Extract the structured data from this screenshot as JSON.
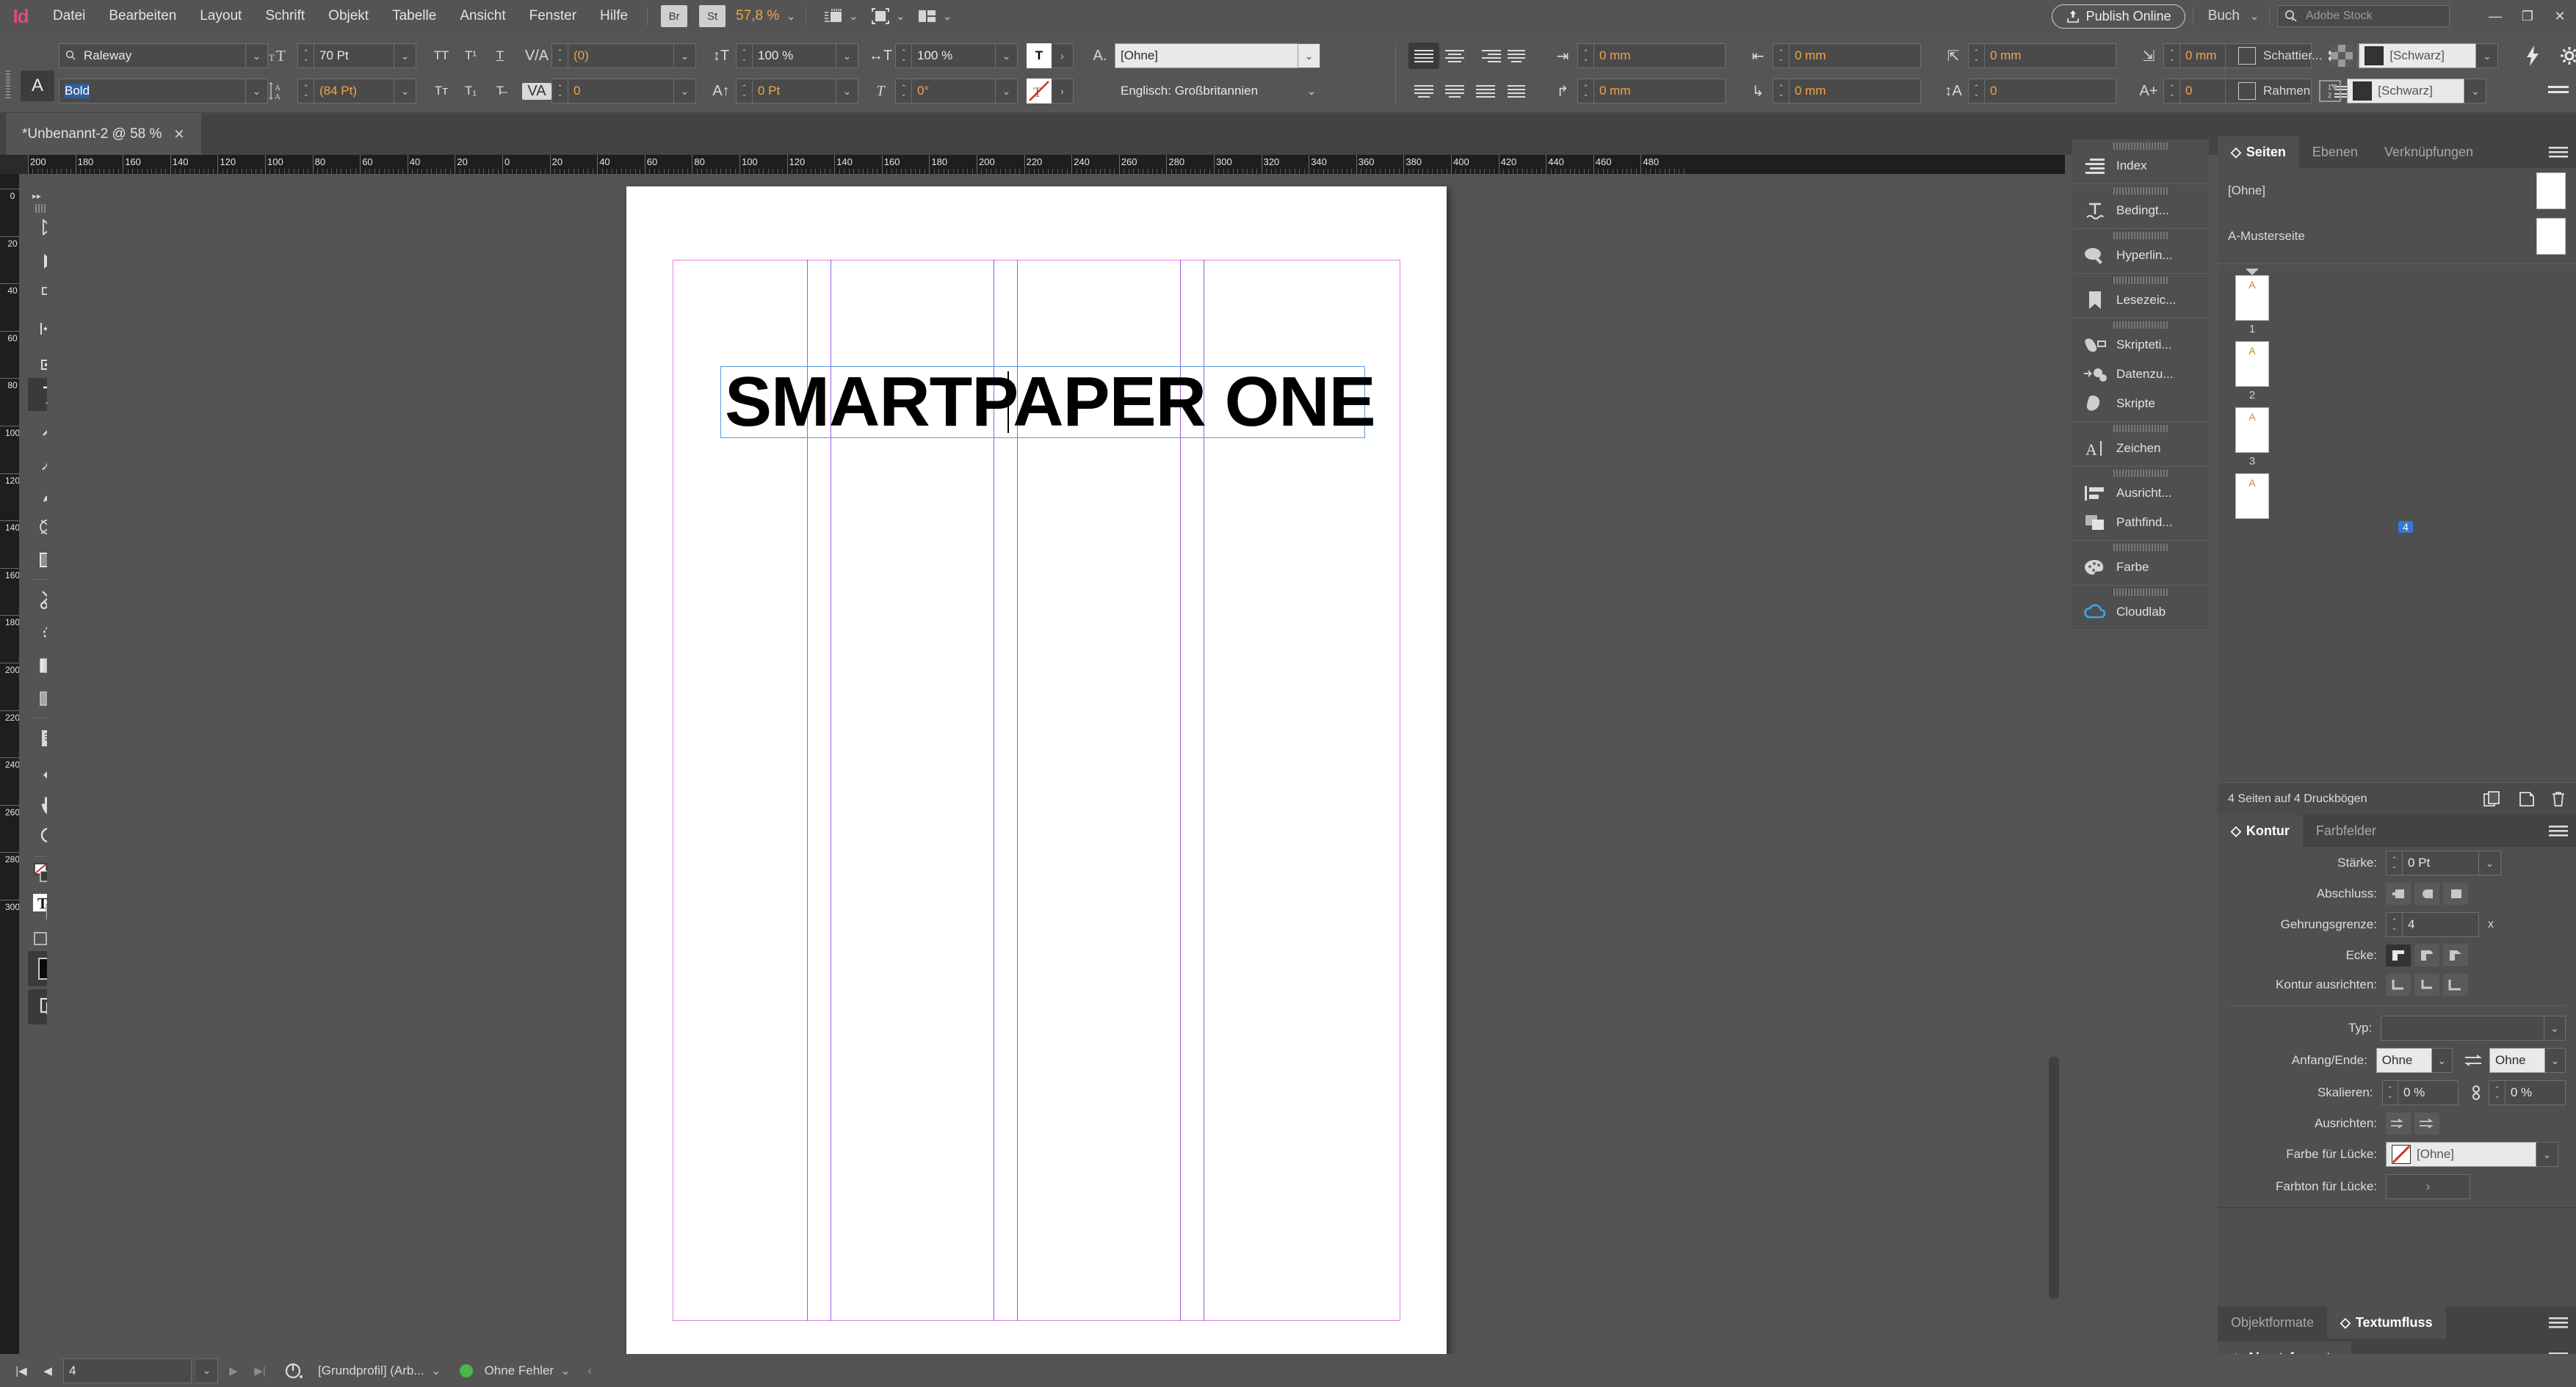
{
  "app": {
    "logo": "Id"
  },
  "menubar": {
    "items": [
      "Datei",
      "Bearbeiten",
      "Layout",
      "Schrift",
      "Objekt",
      "Tabelle",
      "Ansicht",
      "Fenster",
      "Hilfe"
    ],
    "bridge_button": "Br",
    "stock_button": "St",
    "zoom_level": "57,8 %",
    "publish_label": "Publish Online",
    "workspace": "Buch",
    "stock_placeholder": "Adobe Stock",
    "window_minimize": "—",
    "window_restore": "❐",
    "window_close": "✕"
  },
  "control": {
    "mode_char": "A",
    "mode_para": "¶",
    "font_family": "Raleway",
    "font_style": "Bold",
    "font_size": "70 Pt",
    "leading": "(84 Pt)",
    "kerning": "(0)",
    "tracking": "0",
    "vertical_scale": "100 %",
    "horizontal_scale": "100 %",
    "baseline_shift": "0 Pt",
    "skew": "0°",
    "char_style": "[Ohne]",
    "language": "Englisch: Großbritannien",
    "indent_left": "0 mm",
    "indent_right": "0 mm",
    "indent_first": "0 mm",
    "indent_last": "0 mm",
    "space_before": "0 mm",
    "space_after": "0 mm",
    "drop_cap_lines": "0",
    "drop_cap_chars": "0",
    "shadow_label": "Schattier...",
    "frame_label": "Rahmen",
    "shadow_color": "[Schwarz]",
    "frame_color": "[Schwarz]"
  },
  "document_tab": {
    "title": "*Unbenannt-2 @ 58 %",
    "close": "✕"
  },
  "rulers": {
    "horizontal": [
      "200",
      "180",
      "160",
      "140",
      "120",
      "100",
      "80",
      "60",
      "40",
      "20",
      "0",
      "20",
      "40",
      "60",
      "80",
      "100",
      "120",
      "140",
      "160",
      "180",
      "200",
      "220",
      "240",
      "260",
      "280",
      "300",
      "320",
      "340",
      "360",
      "380",
      "400",
      "420",
      "440",
      "460",
      "480"
    ],
    "vertical": [
      "0",
      "20",
      "40",
      "60",
      "80",
      "100",
      "120",
      "140",
      "160",
      "180",
      "200",
      "220",
      "240",
      "260",
      "280",
      "300"
    ],
    "unit": "mm"
  },
  "tools": {
    "items": [
      {
        "name": "selection-tool",
        "glyph": "outline-arrow"
      },
      {
        "name": "direct-selection-tool",
        "glyph": "solid-arrow"
      },
      {
        "name": "page-tool",
        "glyph": "page"
      },
      {
        "name": "gap-tool",
        "glyph": "gap"
      },
      {
        "name": "content-collector-tool",
        "glyph": "collector"
      },
      {
        "name": "type-tool",
        "glyph": "T",
        "active": true
      },
      {
        "name": "line-tool",
        "glyph": "line"
      },
      {
        "name": "pen-tool",
        "glyph": "pen"
      },
      {
        "name": "pencil-tool",
        "glyph": "pencil"
      },
      {
        "name": "ellipse-frame-tool",
        "glyph": "ellipse-frame"
      },
      {
        "name": "rectangle-tool",
        "glyph": "rectangle"
      },
      {
        "name": "scissors-tool",
        "glyph": "scissors"
      },
      {
        "name": "free-transform-tool",
        "glyph": "transform"
      },
      {
        "name": "gradient-swatch-tool",
        "glyph": "gradient"
      },
      {
        "name": "gradient-feather-tool",
        "glyph": "feather"
      },
      {
        "name": "note-tool",
        "glyph": "note"
      },
      {
        "name": "eyedropper-tool",
        "glyph": "eyedropper"
      },
      {
        "name": "hand-tool",
        "glyph": "hand"
      },
      {
        "name": "zoom-tool",
        "glyph": "magnifier"
      }
    ]
  },
  "canvas": {
    "text_frame_content": "SMARTPAPER ONE",
    "frame_border_color": "#5b9bd5",
    "margin_guide_color": "#e47fe4",
    "column_guide_color": "#9b5de5"
  },
  "dock": {
    "groups": [
      [
        {
          "label": "Index",
          "icon": "index-icon"
        }
      ],
      [
        {
          "label": "Bedingt...",
          "icon": "conditional-text-icon"
        }
      ],
      [
        {
          "label": "Hyperlin...",
          "icon": "hyperlinks-icon"
        }
      ],
      [
        {
          "label": "Lesezeic...",
          "icon": "bookmarks-icon"
        }
      ],
      [
        {
          "label": "Skripteti...",
          "icon": "script-label-icon"
        },
        {
          "label": "Datenzu...",
          "icon": "data-merge-icon"
        },
        {
          "label": "Skripte",
          "icon": "scripts-icon"
        }
      ],
      [
        {
          "label": "Zeichen",
          "icon": "character-icon"
        }
      ],
      [
        {
          "label": "Ausricht...",
          "icon": "align-icon"
        },
        {
          "label": "Pathfind...",
          "icon": "pathfinder-icon"
        }
      ],
      [
        {
          "label": "Farbe",
          "icon": "color-icon"
        }
      ],
      [
        {
          "label": "Cloudlab",
          "icon": "cloud-icon"
        }
      ]
    ]
  },
  "pages_panel": {
    "tabs": [
      "Seiten",
      "Ebenen",
      "Verknüpfungen"
    ],
    "active_tab": "Seiten",
    "masters": [
      {
        "label": "[Ohne]"
      },
      {
        "label": "A-Musterseite"
      }
    ],
    "pages": [
      {
        "master": "A",
        "number": "1",
        "selected": false
      },
      {
        "master": "A",
        "number": "2",
        "selected": false
      },
      {
        "master": "A",
        "number": "3",
        "selected": false
      },
      {
        "master": "A",
        "number": "4",
        "selected": true
      }
    ],
    "footer": "4 Seiten auf 4 Druckbögen"
  },
  "stroke_panel": {
    "tabs": [
      "Kontur",
      "Farbfelder"
    ],
    "active_tab": "Kontur",
    "weight_label": "Stärke:",
    "weight_value": "0 Pt",
    "cap_label": "Abschluss:",
    "miter_label": "Gehrungsgrenze:",
    "miter_value": "4",
    "miter_unit": "x",
    "join_label": "Ecke:",
    "align_label": "Kontur ausrichten:",
    "type_label": "Typ:",
    "type_value": "",
    "startend_label": "Anfang/Ende:",
    "start_value": "Ohne",
    "end_value": "Ohne",
    "scale_label": "Skalieren:",
    "scale_start": "0 %",
    "scale_end": "0 %",
    "arrow_align_label": "Ausrichten:",
    "gap_color_label": "Farbe für Lücke:",
    "gap_color_value": "[Ohne]",
    "gap_tint_label": "Farbton für Lücke:"
  },
  "bottom_panels": {
    "object_styles": "Objektformate",
    "text_wrap": "Textumfluss",
    "paragraph_styles": "Absatzformate"
  },
  "status": {
    "page_value": "4",
    "preflight_profile": "[Grundprofil] (Arb...",
    "preflight_status": "Ohne Fehler",
    "preflight_color": "#49b849"
  }
}
